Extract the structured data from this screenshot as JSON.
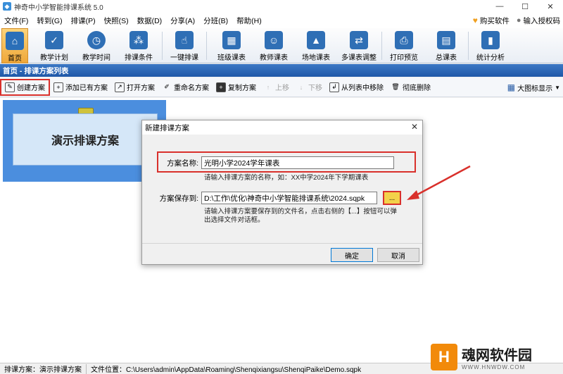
{
  "window": {
    "title": "神奇中小学智能排课系统 5.0",
    "controls": [
      "—",
      "☐",
      "✕"
    ]
  },
  "menu": {
    "items": [
      "文件(F)",
      "转到(G)",
      "排课(P)",
      "快照(S)",
      "数据(D)",
      "分享(A)",
      "分班(B)",
      "帮助(H)"
    ],
    "buy_label": "购买软件",
    "license_label": "输入授权码"
  },
  "toolbar": {
    "items": [
      {
        "label": "首页",
        "icon": "home-icon"
      },
      {
        "label": "教学计划",
        "icon": "clipboard-icon"
      },
      {
        "label": "教学时间",
        "icon": "clock-icon"
      },
      {
        "label": "排课条件",
        "icon": "conditions-icon"
      },
      {
        "label": "一键排课",
        "icon": "hand-pointer-icon"
      },
      {
        "label": "班级课表",
        "icon": "grid-icon"
      },
      {
        "label": "教师课表",
        "icon": "teacher-icon"
      },
      {
        "label": "场地课表",
        "icon": "building-icon"
      },
      {
        "label": "多课表调整",
        "icon": "adjust-icon"
      },
      {
        "label": "打印预览",
        "icon": "printer-icon"
      },
      {
        "label": "总课表",
        "icon": "calendar-icon"
      },
      {
        "label": "统计分析",
        "icon": "chart-icon"
      }
    ]
  },
  "breadcrumb": "首页 - 排课方案列表",
  "actions": {
    "create": "创建方案",
    "add_existing": "添加已有方案",
    "open": "打开方案",
    "rename": "重命名方案",
    "copy": "复制方案",
    "move_up": "上移",
    "move_down": "下移",
    "remove": "从列表中移除",
    "delete": "彻底删除",
    "view_mode": "大图标显示"
  },
  "plan_card": {
    "name": "演示排课方案"
  },
  "dialog": {
    "title": "新建排课方案",
    "name_label": "方案名称:",
    "name_value": "光明小学2024学年课表",
    "name_hint": "请输入排课方案的名称，如：XX中学2024年下学期课表",
    "path_label": "方案保存到:",
    "path_value": "D:\\工作\\优化\\神奇中小学智能排课系统\\2024.sqpk",
    "browse_label": "...",
    "path_hint_1": "请输入排课方案要保存到的文件名，点击右侧的【...】按钮可以弹",
    "path_hint_2": "出选择文件对话框。",
    "ok_label": "确定",
    "cancel_label": "取消"
  },
  "statusbar": {
    "plan": "排课方案：演示排课方案",
    "location": "文件位置：C:\\Users\\admin\\AppData\\Roaming\\Shenqixiangsu\\ShenqiPaike\\Demo.sqpk"
  },
  "watermark": {
    "badge": "H",
    "name": "魂网软件园",
    "url": "WWW.HNWDW.COM"
  },
  "colors": {
    "accent_red": "#d9302b",
    "breadcrumb_blue": "#1f58a8",
    "card_blue": "#4b8ede"
  }
}
